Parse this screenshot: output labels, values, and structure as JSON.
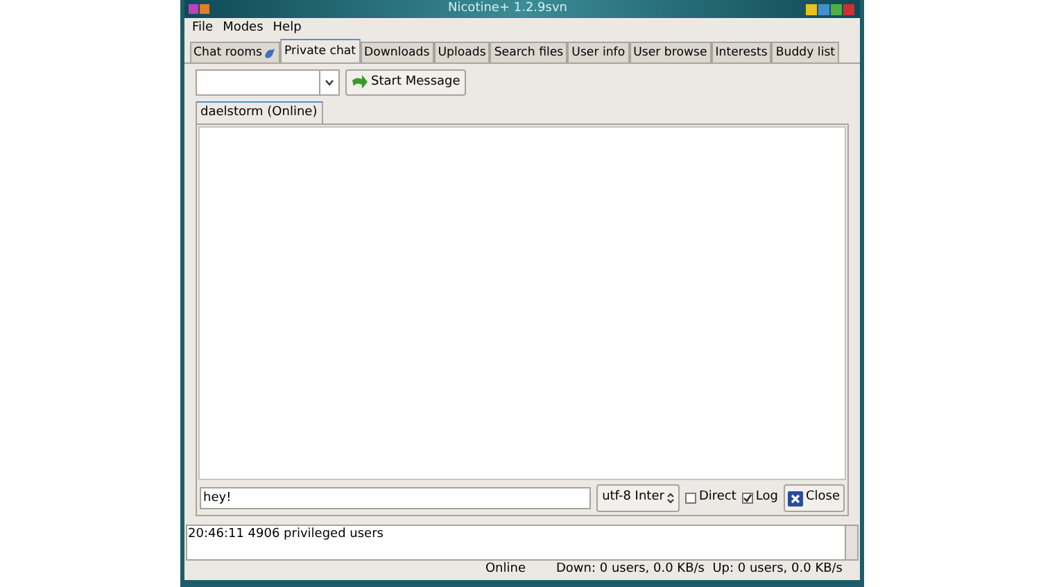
{
  "window": {
    "title": "Nicotine+ 1.2.9svn"
  },
  "menu": [
    "File",
    "Modes",
    "Help"
  ],
  "tabs": [
    {
      "label": "Chat rooms",
      "selected": false
    },
    {
      "label": "Private chat",
      "selected": true
    },
    {
      "label": "Downloads",
      "selected": false
    },
    {
      "label": "Uploads",
      "selected": false
    },
    {
      "label": "Search files",
      "selected": false
    },
    {
      "label": "User info",
      "selected": false
    },
    {
      "label": "User browse",
      "selected": false
    },
    {
      "label": "Interests",
      "selected": false
    },
    {
      "label": "Buddy list",
      "selected": false
    }
  ],
  "toolbar": {
    "start_button": "Start Message"
  },
  "chat_tabs": [
    {
      "label": "daelstorm (Online)",
      "selected": true
    }
  ],
  "input": {
    "value": "hey!"
  },
  "encoding": "utf-8 Inter",
  "options": [
    {
      "label": "Direct",
      "checked": false
    },
    {
      "label": "Log",
      "checked": true
    }
  ],
  "close_button": "Close",
  "log": [
    "20:46:11 4906 privileged users"
  ],
  "status_bar": {
    "status": "Online",
    "transfers": "Down: 0 users, 0.0 KB/s  Up: 0 users, 0.0 KB/s"
  }
}
